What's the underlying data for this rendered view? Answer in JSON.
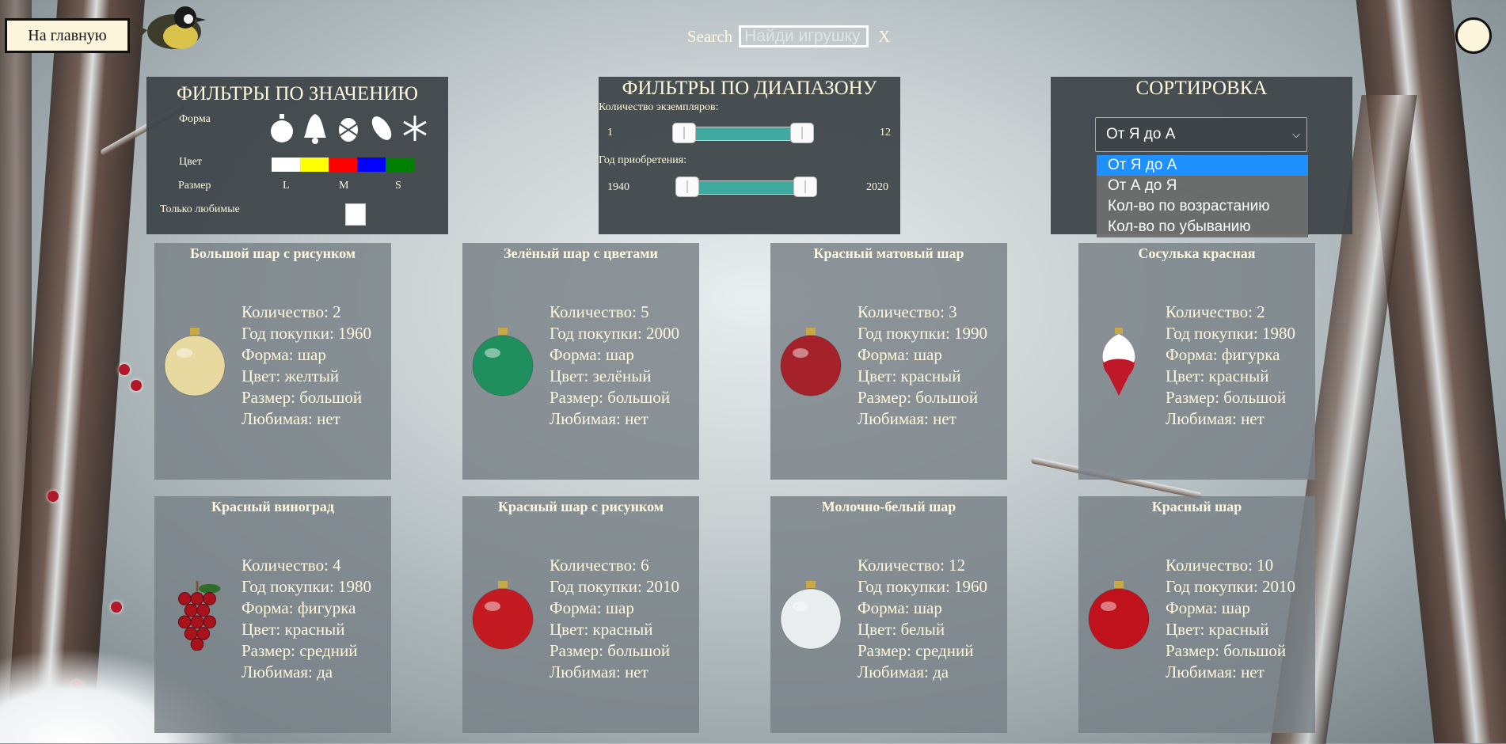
{
  "header": {
    "home_label": "На главную",
    "search_label": "Search",
    "search_placeholder": "Найди игрушку",
    "search_clear": "X"
  },
  "filters_value": {
    "title": "ФИЛЬТРЫ ПО ЗНАЧЕНИЮ",
    "shape_label": "Форма",
    "shapes": [
      "ball-icon",
      "bell-icon",
      "pine-cone-icon",
      "snowflake-icon"
    ],
    "color_label": "Цвет",
    "colors": [
      "#ffffff",
      "#ffff00",
      "#ff0000",
      "#0000ff",
      "#008000"
    ],
    "size_label": "Размер",
    "sizes": [
      "L",
      "M",
      "S"
    ],
    "favorite_label": "Только любимые"
  },
  "filters_range": {
    "title": "ФИЛЬТРЫ ПО ДИАПАЗОНУ",
    "count_label": "Количество экземпляров:",
    "count_min": "1",
    "count_max": "12",
    "year_label": "Год приобретения:",
    "year_min": "1940",
    "year_max": "2020"
  },
  "sort": {
    "title": "СОРТИРОВКА",
    "selected": "От Я до А",
    "options": [
      "От Я до А",
      "От А до Я",
      "Кол-во по возрастанию",
      "Кол-во по убыванию"
    ]
  },
  "cards": [
    {
      "title": "Большой шар с рисунком",
      "count": "Количество: 2",
      "year": "Год покупки: 1960",
      "shape": "Форма: шар",
      "color": "Цвет: желтый",
      "size": "Размер: большой",
      "favorite": "Любимая: нет",
      "icon": "ball-icon",
      "hue": "#e8d9a0"
    },
    {
      "title": "Зелёный шар с цветами",
      "count": "Количество: 5",
      "year": "Год покупки: 2000",
      "shape": "Форма: шар",
      "color": "Цвет: зелёный",
      "size": "Размер: большой",
      "favorite": "Любимая: нет",
      "icon": "ball-icon",
      "hue": "#1f8f5e"
    },
    {
      "title": "Красный матовый шар",
      "count": "Количество: 3",
      "year": "Год покупки: 1990",
      "shape": "Форма: шар",
      "color": "Цвет: красный",
      "size": "Размер: большой",
      "favorite": "Любимая: нет",
      "icon": "ball-icon",
      "hue": "#a6222a"
    },
    {
      "title": "Сосулька красная",
      "count": "Количество: 2",
      "year": "Год покупки: 1980",
      "shape": "Форма: фигурка",
      "color": "Цвет: красный",
      "size": "Размер: большой",
      "favorite": "Любимая: нет",
      "icon": "icicle-icon",
      "hue": "#c01828"
    },
    {
      "title": "Красный виноград",
      "count": "Количество: 4",
      "year": "Год покупки: 1980",
      "shape": "Форма: фигурка",
      "color": "Цвет: красный",
      "size": "Размер: средний",
      "favorite": "Любимая: да",
      "icon": "grapes-icon",
      "hue": "#a8121c"
    },
    {
      "title": "Красный шар с рисунком",
      "count": "Количество: 6",
      "year": "Год покупки: 2010",
      "shape": "Форма: шар",
      "color": "Цвет: красный",
      "size": "Размер: большой",
      "favorite": "Любимая: нет",
      "icon": "ball-icon",
      "hue": "#c41a22"
    },
    {
      "title": "Молочно-белый шар",
      "count": "Количество: 12",
      "year": "Год покупки: 1960",
      "shape": "Форма: шар",
      "color": "Цвет: белый",
      "size": "Размер: средний",
      "favorite": "Любимая: да",
      "icon": "ball-icon",
      "hue": "#e9eded"
    },
    {
      "title": "Красный шар",
      "count": "Количество: 10",
      "year": "Год покупки: 2010",
      "shape": "Форма: шар",
      "color": "Цвет: красный",
      "size": "Размер: большой",
      "favorite": "Любимая: нет",
      "icon": "ball-icon",
      "hue": "#c0121c"
    }
  ]
}
